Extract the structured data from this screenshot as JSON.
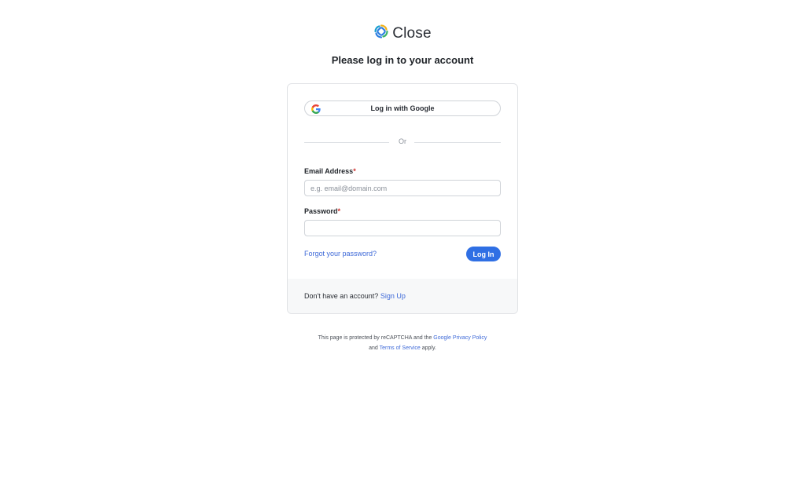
{
  "brand": {
    "name": "Close",
    "icon": "close-logo-icon"
  },
  "title": "Please log in to your account",
  "google": {
    "label": "Log in with Google",
    "icon": "google-icon"
  },
  "divider": {
    "text": "Or"
  },
  "email": {
    "label": "Email Address",
    "required_mark": "*",
    "placeholder": "e.g. email@domain.com",
    "value": ""
  },
  "password": {
    "label": "Password",
    "required_mark": "*",
    "placeholder": "",
    "value": ""
  },
  "forgot_link": "Forgot your password?",
  "login_button": "Log In",
  "signup": {
    "prompt": "Don't have an account?",
    "link": "Sign Up"
  },
  "recaptcha": {
    "text_before": "This page is protected by reCAPTCHA and the",
    "privacy_link": "Google Privacy Policy",
    "text_and": "and",
    "terms_link": "Terms of Service",
    "text_after": "apply."
  },
  "colors": {
    "accent": "#2f6fe4",
    "link": "#3f6ad8",
    "required": "#d0312d"
  }
}
